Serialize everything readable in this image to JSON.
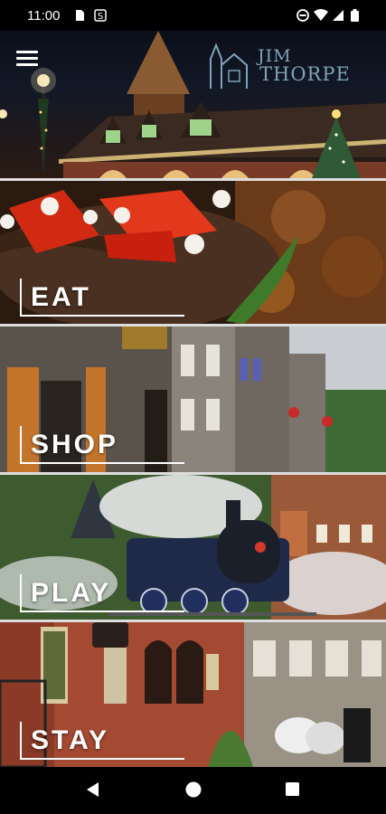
{
  "status": {
    "time": "11:00",
    "left_icons": [
      "sim-icon",
      "s-icon"
    ],
    "right_icons": [
      "do-not-disturb-icon",
      "wifi-icon",
      "signal-icon",
      "battery-icon"
    ]
  },
  "header": {
    "logo_line1": "JIM",
    "logo_line2": "THORPE",
    "menu_icon": "hamburger-menu-icon"
  },
  "tiles": [
    {
      "label": "EAT"
    },
    {
      "label": "SHOP"
    },
    {
      "label": "PLAY"
    },
    {
      "label": "STAY"
    }
  ],
  "nav": {
    "back_icon": "back-triangle-icon",
    "home_icon": "home-circle-icon",
    "recents_icon": "recents-square-icon"
  }
}
